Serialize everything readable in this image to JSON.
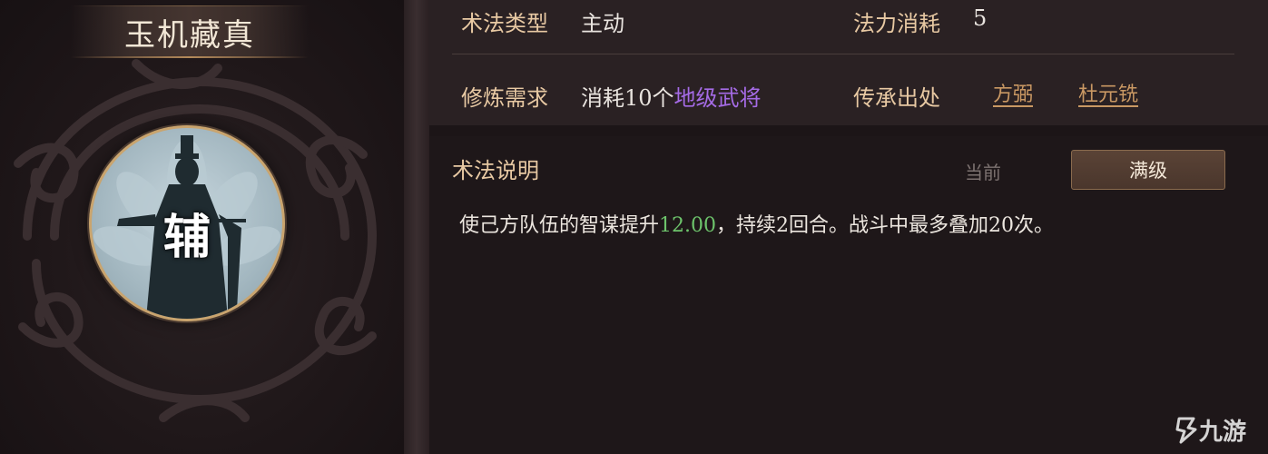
{
  "skill": {
    "name": "玉机藏真",
    "role_char": "辅"
  },
  "info": {
    "type_label": "术法类型",
    "type_value": "主动",
    "cost_label": "法力消耗",
    "cost_value": "5",
    "req_label": "修炼需求",
    "req_prefix": "消耗10个",
    "req_highlight": "地级武将",
    "origin_label": "传承出处",
    "origins": [
      "方弼",
      "杜元铣"
    ]
  },
  "description": {
    "title": "术法说明",
    "tabs": {
      "current": "当前",
      "max": "满级"
    },
    "text_before": "使己方队伍的智谋提升",
    "value": "12.00",
    "text_after": "，持续2回合。战斗中最多叠加20次。"
  },
  "watermark": {
    "text": "九游"
  },
  "colors": {
    "label": "#e8c9a3",
    "highlight_purple": "#a56be6",
    "value_green": "#6dc36b",
    "link": "#c99863",
    "frame_gold": "#c9a46e"
  },
  "icons": {
    "portrait": "strategist-silhouette-icon",
    "watermark": "jiuyou-logo-icon"
  }
}
